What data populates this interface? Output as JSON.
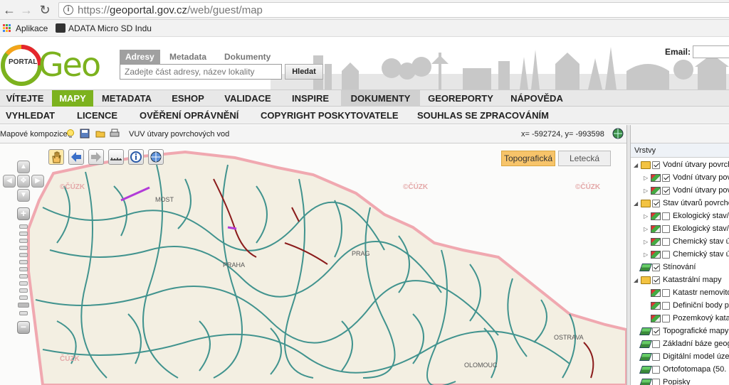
{
  "browser": {
    "url_prefix": "https://",
    "url_host": "geoportal.gov.cz",
    "url_path": "/web/guest/map",
    "bookmarks": [
      "Aplikace",
      "ADATA Micro SD Indu"
    ]
  },
  "logo": {
    "portal": "PORTAL",
    "geo": "Geo"
  },
  "search": {
    "tabs": [
      "Adresy",
      "Metadata",
      "Dokumenty"
    ],
    "placeholder": "Zadejte část adresy, název lokality",
    "button": "Hledat",
    "email_label": "Email:"
  },
  "main_nav": [
    "VÍTEJTE",
    "MAPY",
    "METADATA",
    "ESHOP",
    "VALIDACE",
    "INSPIRE",
    "DOKUMENTY",
    "GEOREPORTY",
    "NÁPOVĚDA"
  ],
  "sub_nav": [
    "VYHLEDAT",
    "LICENCE",
    "OVĚŘENÍ OPRÁVNĚNÍ",
    "COPYRIGHT POSKYTOVATELE",
    "SOUHLAS SE ZPRACOVÁNÍM"
  ],
  "map_toolbar": {
    "label": "Mapové kompozice:",
    "composition": "VUV útvary povrchových vod",
    "coords": "x= -592724, y= -993598"
  },
  "map": {
    "base_layers": [
      "Topografická",
      "Letecká"
    ],
    "watermark": "©ČÚZK",
    "places": [
      "PRAHA",
      "MOST",
      "PRAG",
      "OSTRAVA",
      "OLOMOUC",
      "ČÚZK"
    ]
  },
  "layers": {
    "title": "Vrstvy",
    "items": [
      {
        "label": "Vodní útvary povrch",
        "checked": true
      },
      {
        "label": "Vodní útvary pov",
        "checked": true
      },
      {
        "label": "Vodní útvary pov",
        "checked": true
      },
      {
        "label": "Stav útvarů povrcho",
        "checked": true
      },
      {
        "label": "Ekologický stav/",
        "checked": false
      },
      {
        "label": "Ekologický stav/",
        "checked": false
      },
      {
        "label": "Chemický stav ú",
        "checked": false
      },
      {
        "label": "Chemický stav ú",
        "checked": false
      },
      {
        "label": "Stínování",
        "checked": true
      },
      {
        "label": "Katastrální mapy",
        "checked": true
      },
      {
        "label": "Katastr nemovito",
        "checked": false
      },
      {
        "label": "Definiční body pa",
        "checked": false
      },
      {
        "label": "Pozemkový kata",
        "checked": false
      },
      {
        "label": "Topografické mapy",
        "checked": true
      },
      {
        "label": "Základní báze geog",
        "checked": false
      },
      {
        "label": "Digitální model úzen",
        "checked": false
      },
      {
        "label": "Ortofotomapa (50. le",
        "checked": false
      },
      {
        "label": "Popisky",
        "checked": false
      }
    ]
  }
}
